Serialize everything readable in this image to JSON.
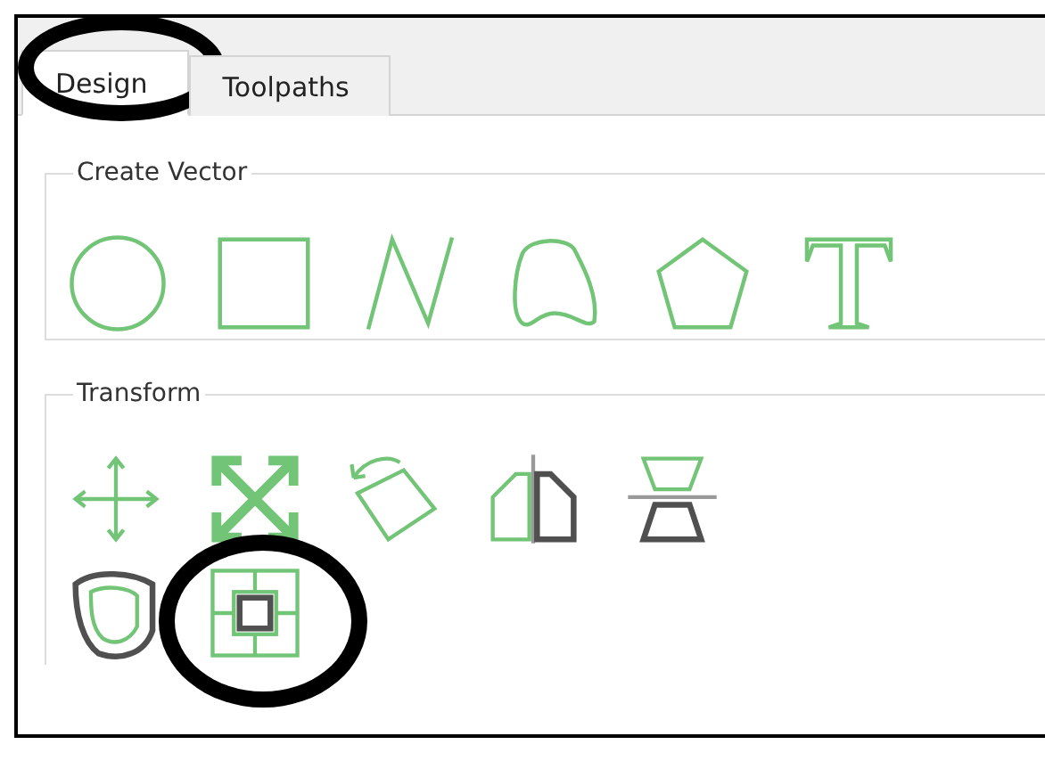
{
  "tabs": [
    {
      "label": "Design",
      "selected": true,
      "circled": true
    },
    {
      "label": "Toolpaths",
      "selected": false,
      "circled": false
    }
  ],
  "groups": [
    {
      "title": "Create Vector",
      "tools": [
        {
          "kind": "circle",
          "circled": false
        },
        {
          "kind": "rectangle",
          "circled": false
        },
        {
          "kind": "polyline",
          "circled": false
        },
        {
          "kind": "freeform",
          "circled": false
        },
        {
          "kind": "polygon",
          "circled": false
        },
        {
          "kind": "text",
          "circled": false
        }
      ]
    },
    {
      "title": "Transform",
      "tools": [
        {
          "kind": "move",
          "circled": false
        },
        {
          "kind": "scale",
          "circled": false
        },
        {
          "kind": "rotate",
          "circled": false
        },
        {
          "kind": "mirror",
          "circled": false
        },
        {
          "kind": "flip",
          "circled": false
        },
        {
          "kind": "offset",
          "circled": false
        },
        {
          "kind": "align",
          "circled": true
        }
      ]
    }
  ]
}
